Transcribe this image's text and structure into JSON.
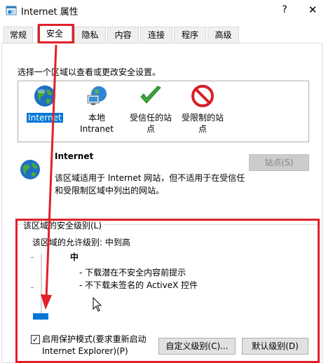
{
  "window": {
    "title": "Internet 属性",
    "help_label": "?",
    "close_label": "✕"
  },
  "tabs": [
    {
      "label": "常规",
      "active": false
    },
    {
      "label": "安全",
      "active": true
    },
    {
      "label": "隐私",
      "active": false
    },
    {
      "label": "内容",
      "active": false
    },
    {
      "label": "连接",
      "active": false
    },
    {
      "label": "程序",
      "active": false
    },
    {
      "label": "高级",
      "active": false
    }
  ],
  "security": {
    "select_label": "选择一个区域以查看或更改安全设置。",
    "zones": [
      {
        "icon": "globe-icon",
        "line1": "Internet",
        "line2": "",
        "selected": true
      },
      {
        "icon": "local-intranet-icon",
        "line1": "本地",
        "line2": "Intranet",
        "selected": false
      },
      {
        "icon": "trusted-sites-icon",
        "line1": "受信任的站",
        "line2": "点",
        "selected": false
      },
      {
        "icon": "restricted-sites-icon",
        "line1": "受限制的站",
        "line2": "点",
        "selected": false
      }
    ],
    "zone_title": "Internet",
    "sites_button": "站点(S)",
    "zone_desc_line1": "该区域适用于 Internet 网站，但不适用于在受信任",
    "zone_desc_line2": "和受限制区域中列出的网站。",
    "level_group_label": "该区域的安全级别(L)",
    "allowed_levels": "该区域的允许级别: 中到高",
    "level_name": "中",
    "level_bullets": [
      "- 下载潜在不安全内容前提示",
      "- 不下载未签名的 ActiveX 控件"
    ],
    "slider_level_position": 0.0,
    "protected_mode_checked": true,
    "protected_mode_line1": "启用保护模式(要求重新启动",
    "protected_mode_line2": "Internet Explorer)(P)",
    "custom_level_button": "自定义级别(C)...",
    "default_level_button": "默认级别(D)"
  },
  "colors": {
    "accent": "#0078d7",
    "highlight_annotation": "#e0202a"
  }
}
